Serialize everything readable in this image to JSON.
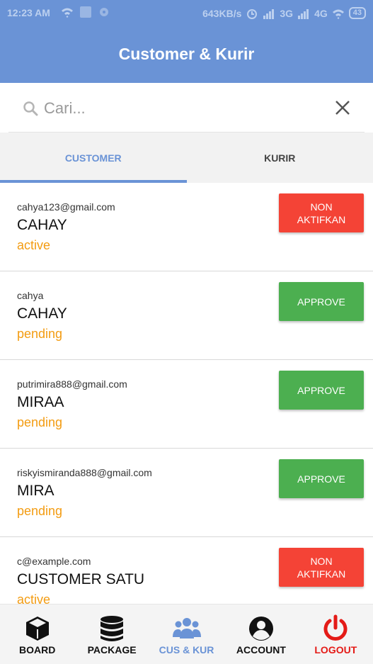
{
  "status_bar": {
    "time": "12:23 AM",
    "network_speed": "643KB/s",
    "net1": "3G",
    "net2": "4G",
    "battery": "43",
    "icons": [
      "wifi-icon",
      "app-icon",
      "settings-icon",
      "alarm-icon",
      "signal-icon",
      "signal-icon",
      "wifi-icon"
    ]
  },
  "app_bar": {
    "title": "Customer & Kurir"
  },
  "search": {
    "placeholder": "Cari...",
    "value": ""
  },
  "tabs": [
    {
      "label": "CUSTOMER",
      "active": true
    },
    {
      "label": "KURIR",
      "active": false
    }
  ],
  "items": [
    {
      "email": "cahya123@gmail.com",
      "name": "CAHAY",
      "status": "active",
      "button": "NON\nAKTIFKAN",
      "button_type": "deactivate"
    },
    {
      "email": "cahya",
      "name": "CAHAY",
      "status": "pending",
      "button": "APPROVE",
      "button_type": "approve"
    },
    {
      "email": "putrimira888@gmail.com",
      "name": "MIRAA",
      "status": "pending",
      "button": "APPROVE",
      "button_type": "approve"
    },
    {
      "email": "riskyismiranda888@gmail.com",
      "name": "MIRA",
      "status": "pending",
      "button": "APPROVE",
      "button_type": "approve"
    },
    {
      "email": "c@example.com",
      "name": "CUSTOMER SATU",
      "status": "active",
      "button": "NON\nAKTIFKAN",
      "button_type": "deactivate"
    }
  ],
  "bottom_nav": [
    {
      "label": "BOARD",
      "icon": "cube-icon",
      "active": false
    },
    {
      "label": "PACKAGE",
      "icon": "database-icon",
      "active": false
    },
    {
      "label": "CUS & KUR",
      "icon": "users-icon",
      "active": true
    },
    {
      "label": "ACCOUNT",
      "icon": "account-circle-icon",
      "active": false
    },
    {
      "label": "LOGOUT",
      "icon": "power-icon",
      "active": false
    }
  ],
  "colors": {
    "primary": "#6a93d6",
    "approve": "#4caf50",
    "deactivate": "#f44336",
    "status": "#f39c12",
    "nav_default": "#111111",
    "logout": "#e41b17"
  }
}
